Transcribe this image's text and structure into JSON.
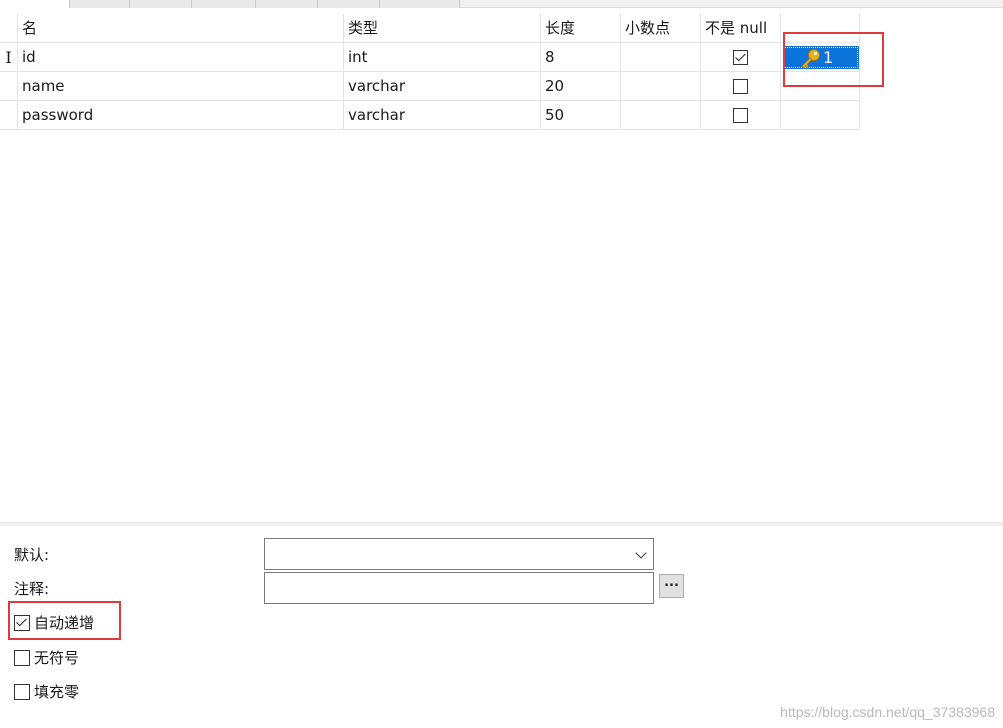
{
  "grid": {
    "columns": [
      "名",
      "类型",
      "长度",
      "小数点",
      "不是 null",
      ""
    ],
    "rows": [
      {
        "name": "id",
        "type": "int",
        "length": "8",
        "decimals": "",
        "not_null": true,
        "key": "1",
        "selected": true
      },
      {
        "name": "name",
        "type": "varchar",
        "length": "20",
        "decimals": "",
        "not_null": false,
        "key": "",
        "selected": false
      },
      {
        "name": "password",
        "type": "varchar",
        "length": "50",
        "decimals": "",
        "not_null": false,
        "key": "",
        "selected": false
      }
    ],
    "row_cursor": "I"
  },
  "properties": {
    "default_label": "默认:",
    "default_value": "",
    "comment_label": "注释:",
    "comment_value": "",
    "ellipsis_label": "...",
    "auto_increment_label": "自动递增",
    "auto_increment": true,
    "unsigned_label": "无符号",
    "unsigned": false,
    "zerofill_label": "填充零",
    "zerofill": false
  },
  "watermark": "https://blog.csdn.net/qq_37383968",
  "colors": {
    "selection": "#0a74da",
    "highlight_box": "#e0393e",
    "key_icon": "#e8b21f"
  },
  "icons": {
    "primary_key": "key-icon"
  }
}
